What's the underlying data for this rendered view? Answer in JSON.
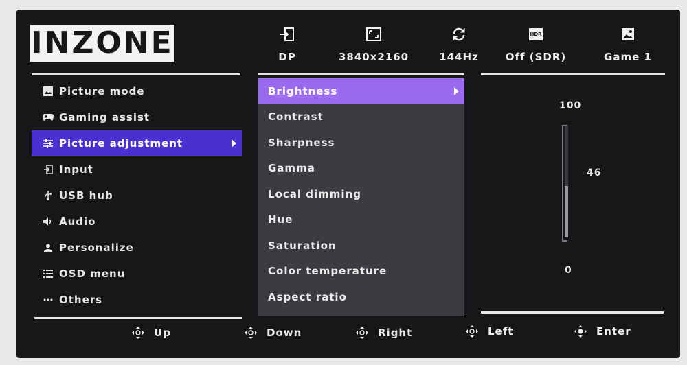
{
  "brand": {
    "logo": "INZONE"
  },
  "status": [
    {
      "icon": "input-icon",
      "label": "DP"
    },
    {
      "icon": "resolution-icon",
      "label": "3840x2160"
    },
    {
      "icon": "refresh-rate-icon",
      "label": "144Hz"
    },
    {
      "icon": "hdr-icon",
      "icon_text": "HDR",
      "label": "Off (SDR)"
    },
    {
      "icon": "picture-mode-icon",
      "label": "Game 1"
    }
  ],
  "left_menu": [
    {
      "icon": "picture-mode-icon",
      "label": "Picture mode",
      "active": false
    },
    {
      "icon": "gamepad-icon",
      "label": "Gaming assist",
      "active": false
    },
    {
      "icon": "sliders-icon",
      "label": "Picture adjustment",
      "active": true
    },
    {
      "icon": "input-icon",
      "label": "Input",
      "active": false
    },
    {
      "icon": "usb-icon",
      "label": "USB hub",
      "active": false
    },
    {
      "icon": "speaker-icon",
      "label": "Audio",
      "active": false
    },
    {
      "icon": "person-icon",
      "label": "Personalize",
      "active": false
    },
    {
      "icon": "list-icon",
      "label": "OSD menu",
      "active": false
    },
    {
      "icon": "more-icon",
      "label": "Others",
      "active": false
    }
  ],
  "sub_menu": [
    {
      "label": "Brightness",
      "active": true
    },
    {
      "label": "Contrast",
      "active": false
    },
    {
      "label": "Sharpness",
      "active": false
    },
    {
      "label": "Gamma",
      "active": false
    },
    {
      "label": "Local dimming",
      "active": false
    },
    {
      "label": "Hue",
      "active": false
    },
    {
      "label": "Saturation",
      "active": false
    },
    {
      "label": "Color temperature",
      "active": false
    },
    {
      "label": "Aspect ratio",
      "active": false
    }
  ],
  "slider": {
    "max_label": "100",
    "min_label": "0",
    "value_label": "46",
    "value": 46,
    "max": 100,
    "min": 0
  },
  "footer": [
    {
      "icon": "joystick-up-icon",
      "label": "Up"
    },
    {
      "icon": "joystick-down-icon",
      "label": "Down"
    },
    {
      "icon": "joystick-right-icon",
      "label": "Right"
    },
    {
      "icon": "joystick-left-icon",
      "label": "Left"
    },
    {
      "icon": "joystick-press-icon",
      "label": "Enter"
    }
  ],
  "colors": {
    "background": "#161719",
    "left_highlight": "#4a2fd1",
    "sub_highlight": "#9a6bef",
    "sub_panel": "#3b3c41"
  }
}
